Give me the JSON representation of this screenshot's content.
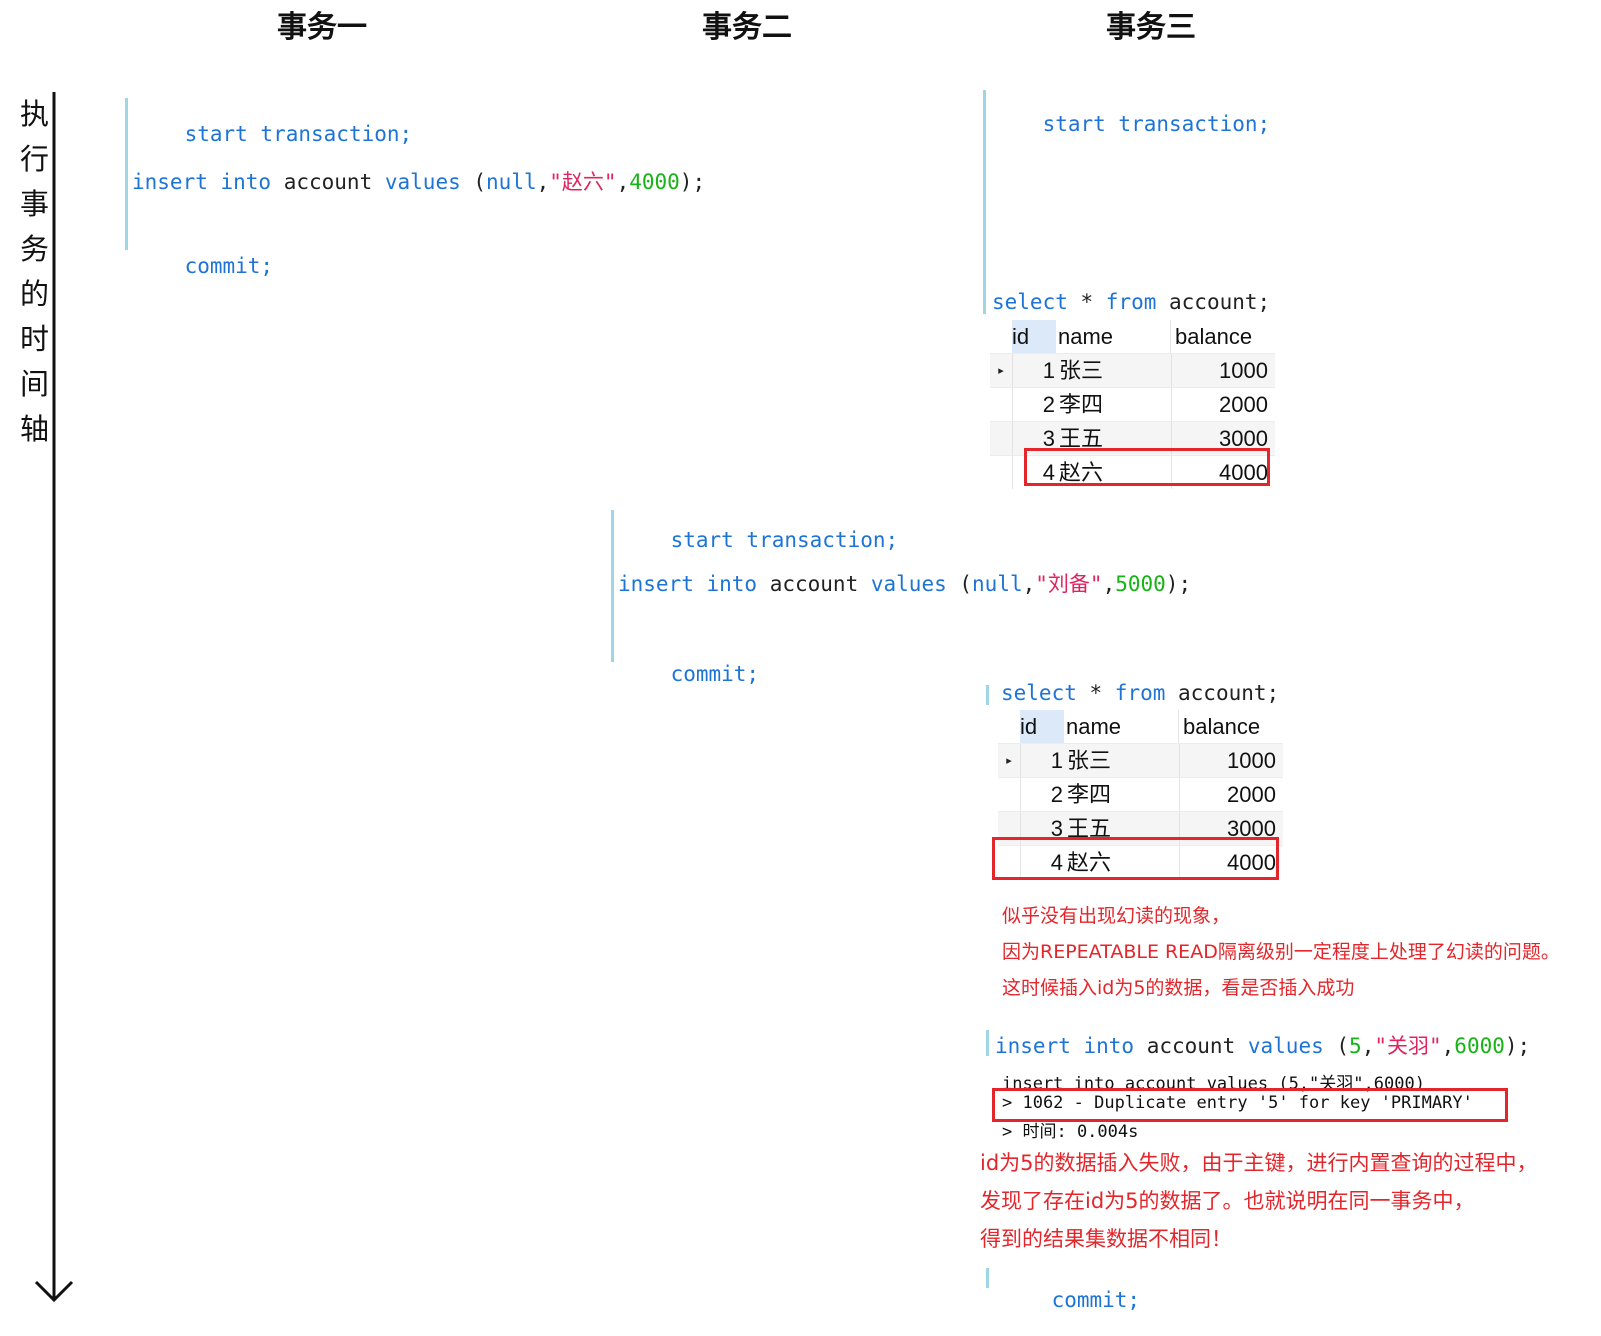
{
  "columns": [
    "事务一",
    "事务二",
    "事务三"
  ],
  "timeline_label": [
    "执",
    "行",
    "事",
    "务",
    "的",
    "时",
    "间",
    "轴"
  ],
  "colors": {
    "keyword": "#1e74d6",
    "string": "#e0245e",
    "number": "#17b317",
    "highlight": "#e3262b",
    "bar": "#9fd6e6"
  },
  "tx1": {
    "start": "start transaction;",
    "insert": {
      "kw1": "insert into",
      "mid": " account ",
      "kw2": "values",
      "open": " (",
      "null": "null",
      "comma1": ",",
      "str": "\"赵六\"",
      "comma2": ",",
      "num": "4000",
      "close": ");"
    },
    "commit": "commit;"
  },
  "tx3a": {
    "start": "start transaction;",
    "select": {
      "kw1": "select",
      "star": " * ",
      "kw2": "from",
      "rest": " account;"
    }
  },
  "tx2": {
    "start": "start transaction;",
    "insert": {
      "kw1": "insert into",
      "mid": " account ",
      "kw2": "values",
      "open": " (",
      "null": "null",
      "comma1": ",",
      "str": "\"刘备\"",
      "comma2": ",",
      "num": "5000",
      "close": ");"
    },
    "commit": "commit;"
  },
  "tx3b": {
    "select": {
      "kw1": "select",
      "star": " * ",
      "kw2": "from",
      "rest": " account;"
    }
  },
  "result_table": {
    "headers": [
      "id",
      "name",
      "balance"
    ],
    "rows": [
      {
        "id": "1",
        "name": "张三",
        "balance": "1000"
      },
      {
        "id": "2",
        "name": "李四",
        "balance": "2000"
      },
      {
        "id": "3",
        "name": "王五",
        "balance": "3000"
      },
      {
        "id": "4",
        "name": "赵六",
        "balance": "4000"
      }
    ],
    "cursor_icon": "row-pointer-icon"
  },
  "note1": [
    "似乎没有出现幻读的现象，",
    "因为REPEATABLE READ隔离级别一定程度上处理了幻读的问题。",
    "这时候插入id为5的数据，看是否插入成功"
  ],
  "tx3c": {
    "insert": {
      "kw1": "insert into",
      "mid": " account ",
      "kw2": "values",
      "open": " (",
      "num1": "5",
      "comma1": ",",
      "str": "\"关羽\"",
      "comma2": ",",
      "num2": "6000",
      "close": ");"
    },
    "echo": "insert into account values (5,\"关羽\",6000)",
    "error": "> 1062 - Duplicate entry '5' for key 'PRIMARY'",
    "time": "> 时间: 0.004s"
  },
  "note2": [
    "id为5的数据插入失败，由于主键，进行内置查询的过程中，",
    "发现了存在id为5的数据了。也就说明在同一事务中，",
    "得到的结果集数据不相同！"
  ],
  "tx3d": {
    "commit": "commit;"
  }
}
